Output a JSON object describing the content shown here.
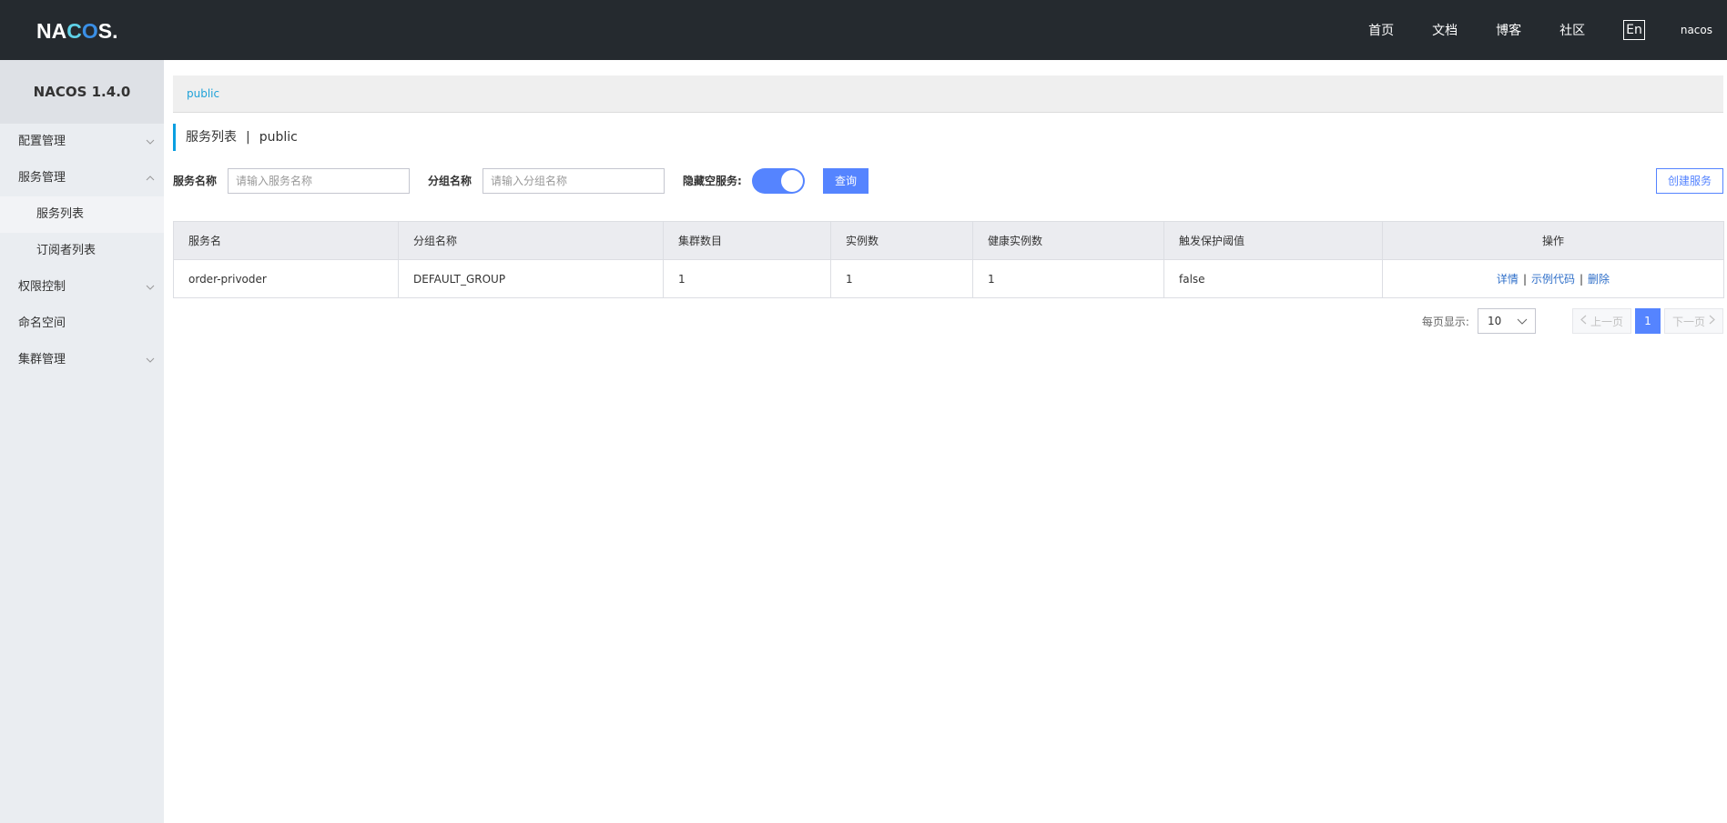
{
  "header": {
    "logo": "NACOS.",
    "nav": [
      "首页",
      "文档",
      "博客",
      "社区"
    ],
    "lang": "En",
    "user": "nacos"
  },
  "sidebar": {
    "version": "NACOS 1.4.0",
    "items": [
      {
        "label": "配置管理",
        "chevron": "chevron-down-icon"
      },
      {
        "label": "服务管理",
        "chevron": "chevron-up-icon"
      },
      {
        "label": "服务列表",
        "active": true
      },
      {
        "label": "订阅者列表"
      },
      {
        "label": "权限控制",
        "chevron": "chevron-down-icon"
      },
      {
        "label": "命名空间"
      },
      {
        "label": "集群管理",
        "chevron": "chevron-down-icon"
      }
    ]
  },
  "namespace": {
    "current": "public"
  },
  "page": {
    "title": "服务列表",
    "separator": "|",
    "namespace": "public"
  },
  "filter": {
    "service_name_label": "服务名称",
    "service_name_placeholder": "请输入服务名称",
    "group_name_label": "分组名称",
    "group_name_placeholder": "请输入分组名称",
    "hide_empty_label": "隐藏空服务:",
    "hide_empty_on": true,
    "query_label": "查询",
    "create_label": "创建服务"
  },
  "table": {
    "columns": [
      "服务名",
      "分组名称",
      "集群数目",
      "实例数",
      "健康实例数",
      "触发保护阈值",
      "操作"
    ],
    "rows": [
      {
        "service": "order-privoder",
        "group": "DEFAULT_GROUP",
        "clusters": "1",
        "instances": "1",
        "healthy": "1",
        "threshold": "false",
        "actions": [
          "详情",
          "示例代码",
          "删除"
        ]
      }
    ]
  },
  "pagination": {
    "page_size_label": "每页显示:",
    "page_size": "10",
    "prev_label": "上一页",
    "current_page": "1",
    "next_label": "下一页"
  },
  "colors": {
    "header_bg": "#252a2f",
    "sidebar_bg": "#eaedf1",
    "primary": "#5584ff",
    "link": "#2f6fc9",
    "title_accent": "#0a9fe1"
  }
}
